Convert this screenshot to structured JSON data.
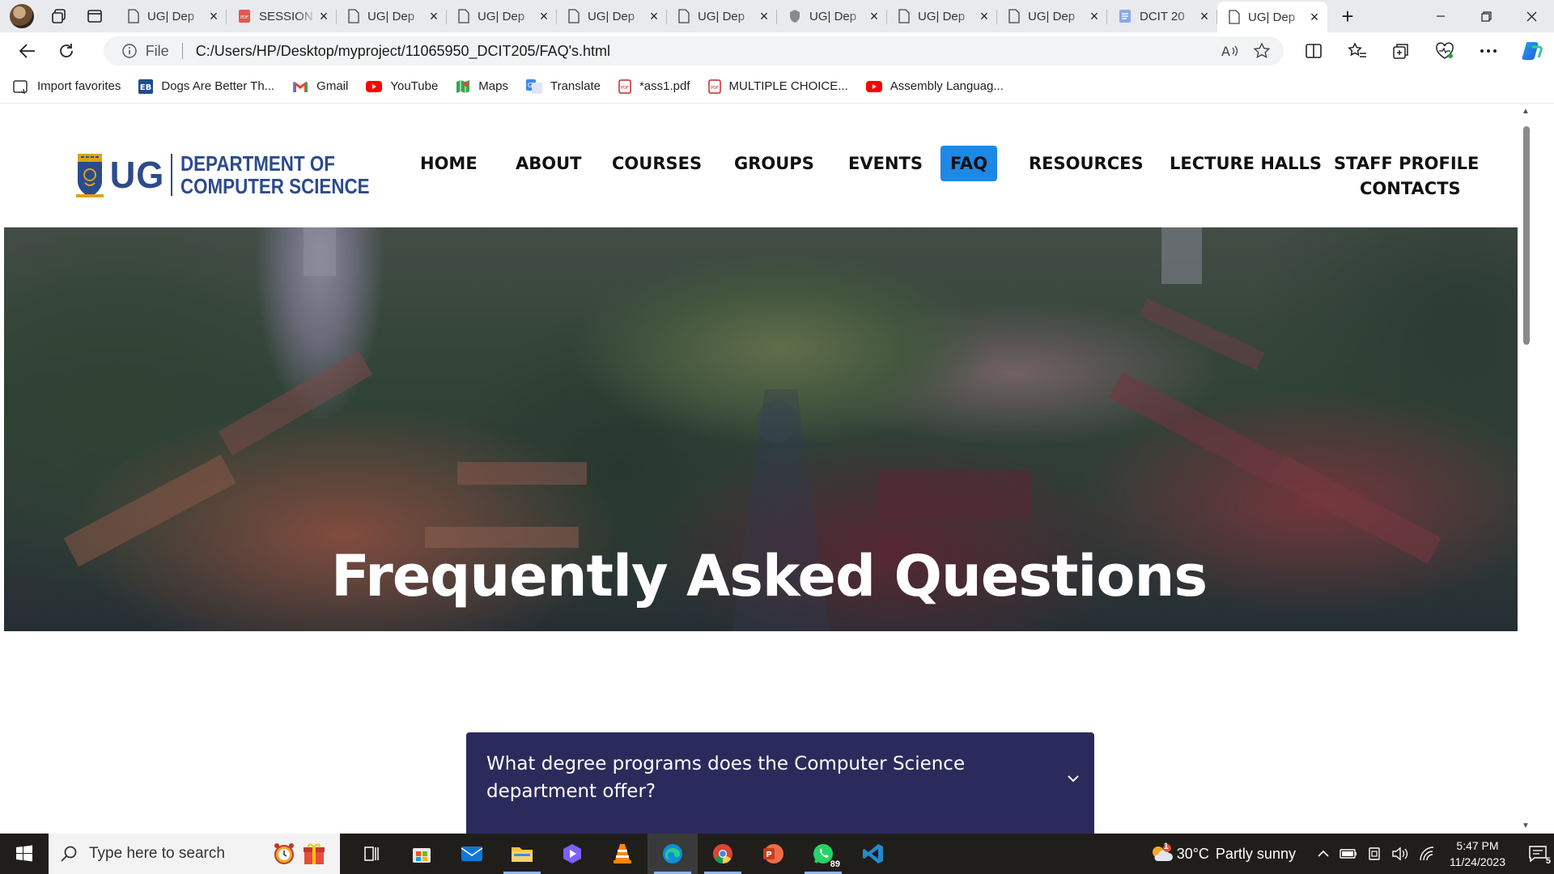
{
  "browser": {
    "tabs": [
      {
        "title": "UG| Dep",
        "icon": "page-icon"
      },
      {
        "title": "SESSION",
        "icon": "pdf-icon"
      },
      {
        "title": "UG| Dep",
        "icon": "page-icon"
      },
      {
        "title": "UG| Dep",
        "icon": "page-icon"
      },
      {
        "title": "UG| Dep",
        "icon": "page-icon"
      },
      {
        "title": "UG| Dep",
        "icon": "page-icon"
      },
      {
        "title": "UG| Dep",
        "icon": "shield-icon"
      },
      {
        "title": "UG| Dep",
        "icon": "page-icon"
      },
      {
        "title": "UG| Dep",
        "icon": "page-icon"
      },
      {
        "title": "DCIT 20",
        "icon": "doc-icon"
      },
      {
        "title": "UG| Dep",
        "icon": "page-icon",
        "active": true
      }
    ],
    "address": {
      "scheme_label": "File",
      "url": "C:/Users/HP/Desktop/myproject/11065950_DCIT205/FAQ's.html"
    },
    "favorites": [
      {
        "label": "Import favorites",
        "icon": "import-icon"
      },
      {
        "label": "Dogs Are Better Th...",
        "icon": "eb-icon"
      },
      {
        "label": "Gmail",
        "icon": "gmail-icon"
      },
      {
        "label": "YouTube",
        "icon": "youtube-icon"
      },
      {
        "label": "Maps",
        "icon": "maps-icon"
      },
      {
        "label": "Translate",
        "icon": "translate-icon"
      },
      {
        "label": "*ass1.pdf",
        "icon": "pdf-icon"
      },
      {
        "label": "MULTIPLE CHOICE...",
        "icon": "pdf-icon"
      },
      {
        "label": "Assembly Languag...",
        "icon": "youtube-icon"
      }
    ]
  },
  "site": {
    "logo": {
      "ug": "UG",
      "line1": "DEPARTMENT OF",
      "line2": "COMPUTER SCIENCE"
    },
    "nav": [
      "HOME",
      "ABOUT",
      "COURSES",
      "GROUPS",
      "EVENTS",
      "FAQ",
      "RESOURCES",
      "LECTURE HALLS",
      "STAFF PROFILE",
      "CONTACTS"
    ],
    "active_nav": "FAQ",
    "hero_title": "Frequently Asked Questions",
    "faq": [
      {
        "question": "What degree programs does the Computer Science department offer?"
      }
    ],
    "colors": {
      "accent": "#1e88e5",
      "faq_bg": "#2b2a5c",
      "logo": "#2c4b8c"
    }
  },
  "taskbar": {
    "search_placeholder": "Type here to search",
    "weather": {
      "temp": "30°C",
      "condition": "Partly sunny"
    },
    "time": "5:47 PM",
    "date": "11/24/2023",
    "whatsapp_badge": "89",
    "notification_count": "5",
    "weather_badge": "1"
  }
}
